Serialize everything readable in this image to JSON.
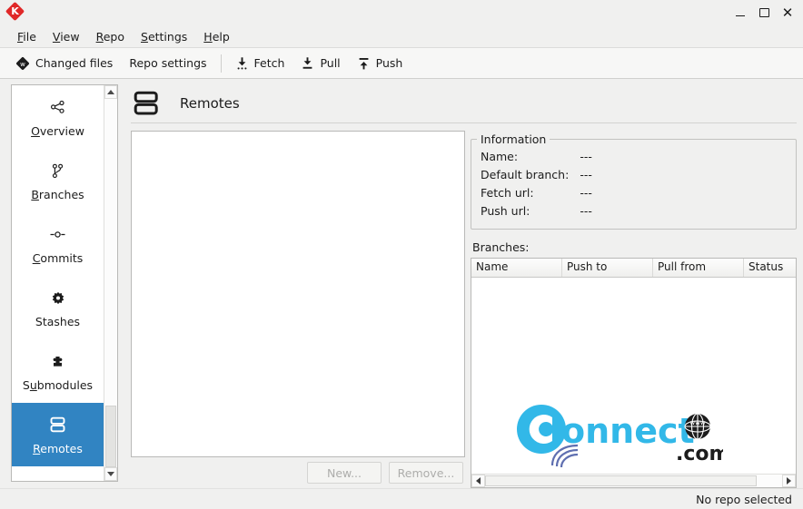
{
  "window": {
    "app_icon": "gitqlient-diamond-k-icon",
    "controls": {
      "minimize": "minimize-icon",
      "maximize": "maximize-icon",
      "close": "close-icon"
    }
  },
  "menubar": {
    "items": [
      {
        "label": "File",
        "accel": "F"
      },
      {
        "label": "View",
        "accel": "V"
      },
      {
        "label": "Repo",
        "accel": "R"
      },
      {
        "label": "Settings",
        "accel": "S"
      },
      {
        "label": "Help",
        "accel": "H"
      }
    ]
  },
  "toolbar": {
    "changed_files": "Changed files",
    "repo_settings": "Repo settings",
    "fetch": "Fetch",
    "pull": "Pull",
    "push": "Push"
  },
  "sidebar": {
    "items": [
      {
        "label": "Overview",
        "pre": "",
        "accel": "O",
        "post": "verview",
        "icon": "share-nodes-icon",
        "selected": false
      },
      {
        "label": "Branches",
        "pre": "",
        "accel": "B",
        "post": "ranches",
        "icon": "branch-icon",
        "selected": false
      },
      {
        "label": "Commits",
        "pre": "",
        "accel": "C",
        "post": "ommits",
        "icon": "commit-node-icon",
        "selected": false
      },
      {
        "label": "Stashes",
        "pre": "Stashes",
        "accel": "",
        "post": "",
        "icon": "gear-icon",
        "selected": false
      },
      {
        "label": "Submodules",
        "pre": "S",
        "accel": "u",
        "post": "bmodules",
        "icon": "puzzle-piece-icon",
        "selected": false
      },
      {
        "label": "Remotes",
        "pre": "R",
        "accel": "e",
        "post": "motes",
        "icon": "remotes-stack-icon",
        "selected": true
      }
    ],
    "scrollbar": {
      "up": "scroll-up-arrow-icon",
      "down": "scroll-down-arrow-icon"
    }
  },
  "page": {
    "title": "Remotes",
    "icon": "remotes-stack-icon"
  },
  "remotes_panel": {
    "buttons": {
      "new": "New...",
      "remove": "Remove...",
      "new_enabled": false,
      "remove_enabled": false
    }
  },
  "information": {
    "title": "Information",
    "rows": [
      {
        "label": "Name:",
        "value": "---"
      },
      {
        "label": "Default branch:",
        "value": "---"
      },
      {
        "label": "Fetch url:",
        "value": "---"
      },
      {
        "label": "Push url:",
        "value": "---"
      }
    ]
  },
  "branches": {
    "label": "Branches:",
    "columns": [
      "Name",
      "Push to",
      "Pull from",
      "Status"
    ],
    "rows": [],
    "scrollbar": {
      "left": "scroll-left-arrow-icon",
      "right": "scroll-right-arrow-icon"
    }
  },
  "statusbar": {
    "text": "No repo selected"
  },
  "watermark": {
    "text_main": "Connect",
    "text_sub": ".com",
    "globe_text": "www",
    "color": "#32b8e8"
  },
  "colors": {
    "selection_blue": "#3184c2",
    "window_bg": "#f0f0ef",
    "toolbar_bg": "#f7f7f6",
    "panel_white": "#ffffff",
    "border_gray": "#b9b9b7"
  }
}
